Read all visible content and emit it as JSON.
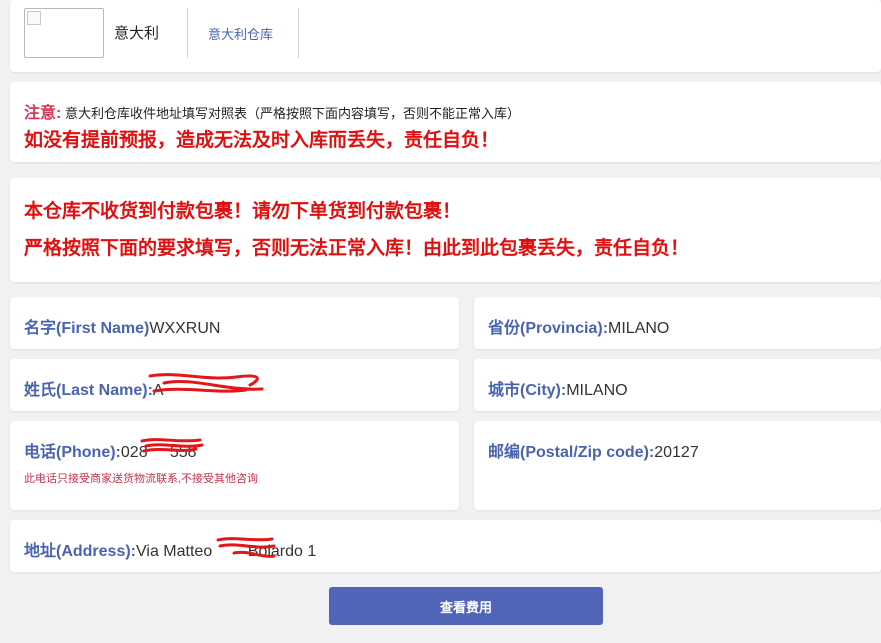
{
  "header": {
    "brand_name": "意大利",
    "nav_link": "意大利仓库"
  },
  "notice": {
    "label": "注意:",
    "text": "意大利仓库收件地址填写对照表（严格按照下面内容填写，否则不能正常入库）",
    "warning": "如没有提前预报，造成无法及时入库而丢失，责任自负！"
  },
  "policy": {
    "line1": "本仓库不收货到付款包裹！请勿下单货到付款包裹！",
    "line2": "严格按照下面的要求填写，否则无法正常入库！由此到此包裹丢失，责任自负！"
  },
  "fields": {
    "first_name": {
      "label": "名字(First Name)",
      "value": "WXXRUN"
    },
    "province": {
      "label": "省份(Provincia):",
      "value": "MILANO"
    },
    "last_name": {
      "label": "姓氏(Last Name):",
      "value": "A"
    },
    "city": {
      "label": "城市(City):",
      "value": "MILANO"
    },
    "phone": {
      "label": "电话(Phone):",
      "value": "028",
      "value_end": "558",
      "note": "此电话只接受商家送货物流联系,不接受其他咨询"
    },
    "postal": {
      "label": "邮编(Postal/Zip code):",
      "value": "20127"
    },
    "address": {
      "label": "地址(Address):",
      "value": "Via Matteo ",
      "value_end": " Boiardo 1"
    }
  },
  "button": {
    "label": "查看费用"
  },
  "colors": {
    "accent": "#4a63b0",
    "warning_red": "#e01010",
    "button": "#5064b8"
  }
}
